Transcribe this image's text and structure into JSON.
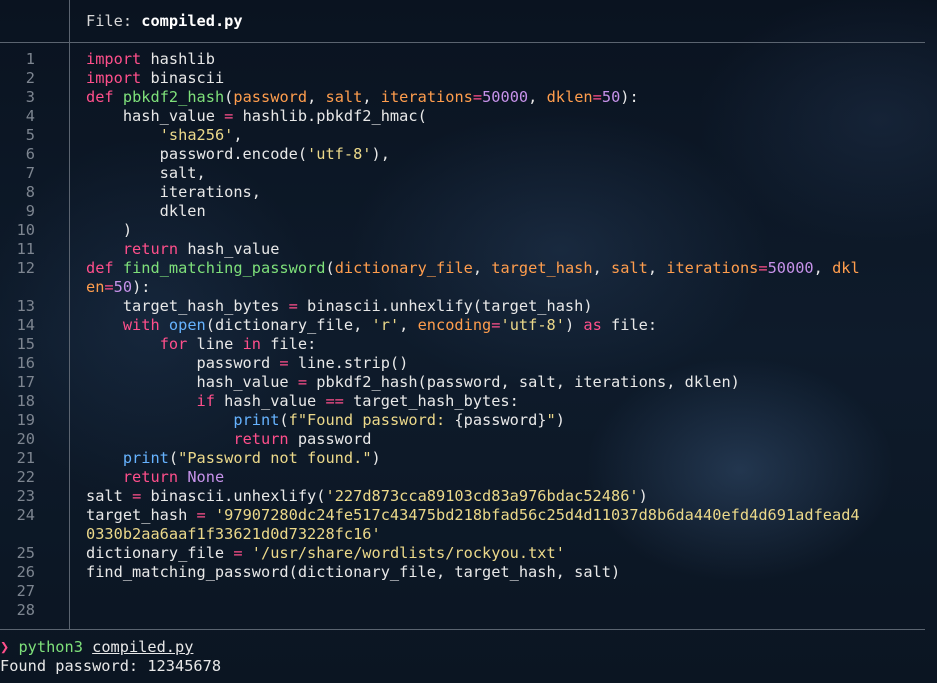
{
  "header": {
    "label": "File: ",
    "filename": "compiled.py"
  },
  "code_lines": [
    {
      "n": "1",
      "t": [
        [
          "kw",
          "import"
        ],
        [
          "p",
          " hashlib"
        ]
      ]
    },
    {
      "n": "2",
      "t": [
        [
          "kw",
          "import"
        ],
        [
          "p",
          " binascii"
        ]
      ]
    },
    {
      "n": "3",
      "t": [
        [
          "kw",
          "def"
        ],
        [
          "p",
          " "
        ],
        [
          "fn",
          "pbkdf2_hash"
        ],
        [
          "p",
          "("
        ],
        [
          "pa",
          "password"
        ],
        [
          "p",
          ", "
        ],
        [
          "pa",
          "salt"
        ],
        [
          "p",
          ", "
        ],
        [
          "pa",
          "iterations"
        ],
        [
          "op",
          "="
        ],
        [
          "nu",
          "50000"
        ],
        [
          "p",
          ", "
        ],
        [
          "pa",
          "dklen"
        ],
        [
          "op",
          "="
        ],
        [
          "nu",
          "50"
        ],
        [
          "p",
          "):"
        ]
      ]
    },
    {
      "n": "4",
      "t": [
        [
          "p",
          "    hash_value "
        ],
        [
          "op",
          "="
        ],
        [
          "p",
          " hashlib.pbkdf2_hmac("
        ]
      ]
    },
    {
      "n": "5",
      "t": [
        [
          "p",
          "        "
        ],
        [
          "st",
          "'sha256'"
        ],
        [
          "p",
          ","
        ]
      ]
    },
    {
      "n": "6",
      "t": [
        [
          "p",
          "        password.encode("
        ],
        [
          "st",
          "'utf-8'"
        ],
        [
          "p",
          "),"
        ]
      ]
    },
    {
      "n": "7",
      "t": [
        [
          "p",
          "        salt,"
        ]
      ]
    },
    {
      "n": "8",
      "t": [
        [
          "p",
          "        iterations,"
        ]
      ]
    },
    {
      "n": "9",
      "t": [
        [
          "p",
          "        dklen"
        ]
      ]
    },
    {
      "n": "10",
      "t": [
        [
          "p",
          "    )"
        ]
      ]
    },
    {
      "n": "11",
      "t": [
        [
          "p",
          "    "
        ],
        [
          "kw",
          "return"
        ],
        [
          "p",
          " hash_value"
        ]
      ]
    },
    {
      "n": "12",
      "t": [
        [
          "kw",
          "def"
        ],
        [
          "p",
          " "
        ],
        [
          "fn",
          "find_matching_password"
        ],
        [
          "p",
          "("
        ],
        [
          "pa",
          "dictionary_file"
        ],
        [
          "p",
          ", "
        ],
        [
          "pa",
          "target_hash"
        ],
        [
          "p",
          ", "
        ],
        [
          "pa",
          "salt"
        ],
        [
          "p",
          ", "
        ],
        [
          "pa",
          "iterations"
        ],
        [
          "op",
          "="
        ],
        [
          "nu",
          "50000"
        ],
        [
          "p",
          ", "
        ],
        [
          "pa",
          "dkl"
        ]
      ]
    },
    {
      "n": "",
      "t": [
        [
          "pa",
          "en"
        ],
        [
          "op",
          "="
        ],
        [
          "nu",
          "50"
        ],
        [
          "p",
          "):"
        ]
      ]
    },
    {
      "n": "13",
      "t": [
        [
          "p",
          "    target_hash_bytes "
        ],
        [
          "op",
          "="
        ],
        [
          "p",
          " binascii.unhexlify(target_hash)"
        ]
      ]
    },
    {
      "n": "14",
      "t": [
        [
          "p",
          "    "
        ],
        [
          "kw",
          "with"
        ],
        [
          "p",
          " "
        ],
        [
          "bi",
          "open"
        ],
        [
          "p",
          "(dictionary_file, "
        ],
        [
          "st",
          "'r'"
        ],
        [
          "p",
          ", "
        ],
        [
          "pa",
          "encoding"
        ],
        [
          "op",
          "="
        ],
        [
          "st",
          "'utf-8'"
        ],
        [
          "p",
          ") "
        ],
        [
          "kw",
          "as"
        ],
        [
          "p",
          " file:"
        ]
      ]
    },
    {
      "n": "15",
      "t": [
        [
          "p",
          "        "
        ],
        [
          "kw",
          "for"
        ],
        [
          "p",
          " line "
        ],
        [
          "kw",
          "in"
        ],
        [
          "p",
          " file:"
        ]
      ]
    },
    {
      "n": "16",
      "t": [
        [
          "p",
          "            password "
        ],
        [
          "op",
          "="
        ],
        [
          "p",
          " line.strip()"
        ]
      ]
    },
    {
      "n": "17",
      "t": [
        [
          "p",
          "            hash_value "
        ],
        [
          "op",
          "="
        ],
        [
          "p",
          " pbkdf2_hash(password, salt, iterations, dklen)"
        ]
      ]
    },
    {
      "n": "18",
      "t": [
        [
          "p",
          "            "
        ],
        [
          "kw",
          "if"
        ],
        [
          "p",
          " hash_value "
        ],
        [
          "op",
          "=="
        ],
        [
          "p",
          " target_hash_bytes:"
        ]
      ]
    },
    {
      "n": "19",
      "t": [
        [
          "p",
          "                "
        ],
        [
          "bi",
          "print"
        ],
        [
          "p",
          "("
        ],
        [
          "st",
          "f\"Found password: "
        ],
        [
          "p",
          "{password}"
        ],
        [
          "st",
          "\""
        ],
        [
          "p",
          ")"
        ]
      ]
    },
    {
      "n": "20",
      "t": [
        [
          "p",
          "                "
        ],
        [
          "kw",
          "return"
        ],
        [
          "p",
          " password"
        ]
      ]
    },
    {
      "n": "21",
      "t": [
        [
          "p",
          "    "
        ],
        [
          "bi",
          "print"
        ],
        [
          "p",
          "("
        ],
        [
          "st",
          "\"Password not found.\""
        ],
        [
          "p",
          ")"
        ]
      ]
    },
    {
      "n": "22",
      "t": [
        [
          "p",
          "    "
        ],
        [
          "kw",
          "return"
        ],
        [
          "p",
          " "
        ],
        [
          "nu",
          "None"
        ]
      ]
    },
    {
      "n": "23",
      "t": [
        [
          "p",
          "salt "
        ],
        [
          "op",
          "="
        ],
        [
          "p",
          " binascii.unhexlify("
        ],
        [
          "st",
          "'227d873cca89103cd83a976bdac52486'"
        ],
        [
          "p",
          ")"
        ]
      ]
    },
    {
      "n": "24",
      "t": [
        [
          "p",
          "target_hash "
        ],
        [
          "op",
          "="
        ],
        [
          "p",
          " "
        ],
        [
          "st",
          "'97907280dc24fe517c43475bd218bfad56c25d4d11037d8b6da440efd4d691adfead4"
        ]
      ]
    },
    {
      "n": "",
      "t": [
        [
          "st",
          "0330b2aa6aaf1f33621d0d73228fc16'"
        ]
      ]
    },
    {
      "n": "25",
      "t": [
        [
          "p",
          "dictionary_file "
        ],
        [
          "op",
          "="
        ],
        [
          "p",
          " "
        ],
        [
          "st",
          "'/usr/share/wordlists/rockyou.txt'"
        ]
      ]
    },
    {
      "n": "26",
      "t": [
        [
          "p",
          "find_matching_password(dictionary_file, target_hash, salt)"
        ]
      ]
    },
    {
      "n": "27",
      "t": []
    },
    {
      "n": "28",
      "t": []
    }
  ],
  "terminal": {
    "prompt_symbol": "❯",
    "command": "python3",
    "argument": "compiled.py",
    "output": "Found password: 12345678"
  }
}
